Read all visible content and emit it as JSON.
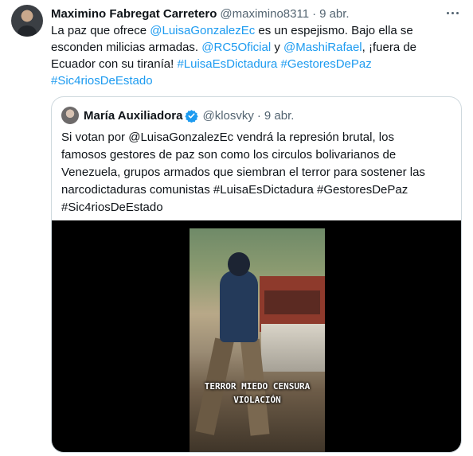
{
  "tweet": {
    "author_name": "Maximino Fabregat Carretero",
    "handle": "@maximino8311",
    "separator": "·",
    "time": "9 abr.",
    "lines": [
      [
        {
          "t": "La paz que ofrece ",
          "link": false
        },
        {
          "t": "@LuisaGonzalezEc",
          "link": true
        },
        {
          "t": " es un espejismo. Bajo ella se",
          "link": false
        }
      ],
      [
        {
          "t": "esconden milicias armadas. ",
          "link": false
        },
        {
          "t": "@RC5Oficial",
          "link": true
        },
        {
          "t": " y ",
          "link": false
        },
        {
          "t": "@MashiRafael",
          "link": true
        },
        {
          "t": ", ¡fuera de",
          "link": false
        }
      ],
      [
        {
          "t": "Ecuador con su tiranía! ",
          "link": false
        },
        {
          "t": "#LuisaEsDictadura",
          "link": true
        },
        {
          "t": " ",
          "link": false
        },
        {
          "t": "#GestoresDePaz",
          "link": true
        }
      ],
      [
        {
          "t": "#Sic4riosDeEstado",
          "link": true
        }
      ]
    ]
  },
  "quoted": {
    "author_name": "María Auxiliadora",
    "handle": "@klosvky",
    "separator": "·",
    "time": "9 abr.",
    "lines": [
      "Si votan por @LuisaGonzalezEc vendrá la represión brutal, los",
      "famosos gestores de paz son como los circulos bolivarianos de",
      "Venezuela, grupos armados que siembran el terror para sostener las",
      "narcodictaduras comunistas #LuisaEsDictadura #GestoresDePaz",
      "#Sic4riosDeEstado"
    ],
    "video_caption_line1": "TERROR MIEDO CENSURA",
    "video_caption_line2": "VIOLACIÓN"
  },
  "colors": {
    "link": "#1d9bf0",
    "text": "#0f1419",
    "secondary": "#536471",
    "border": "#cfd9de",
    "verified": "#1d9bf0"
  }
}
